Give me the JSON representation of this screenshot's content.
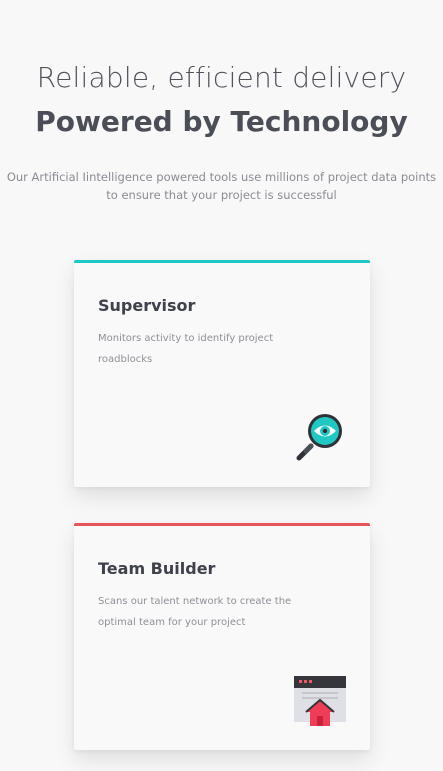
{
  "hero": {
    "subtitle": "Reliable, efficient delivery",
    "title": "Powered by Technology",
    "description": "Our Artificial Iintelligence powered tools use millions of project data points to ensure that your project is successful"
  },
  "cards": [
    {
      "title": "Supervisor",
      "description": "Monitors activity to identify project roadblocks",
      "accent_color": "#1fc8c4",
      "icon": "magnifier-eye-icon"
    },
    {
      "title": "Team Builder",
      "description": "Scans our talent network to create the optimal team for your project",
      "accent_color": "#e5565b",
      "icon": "team-window-icon"
    }
  ],
  "colors": {
    "background": "#f8f8f9",
    "text": "#4b4d57"
  }
}
